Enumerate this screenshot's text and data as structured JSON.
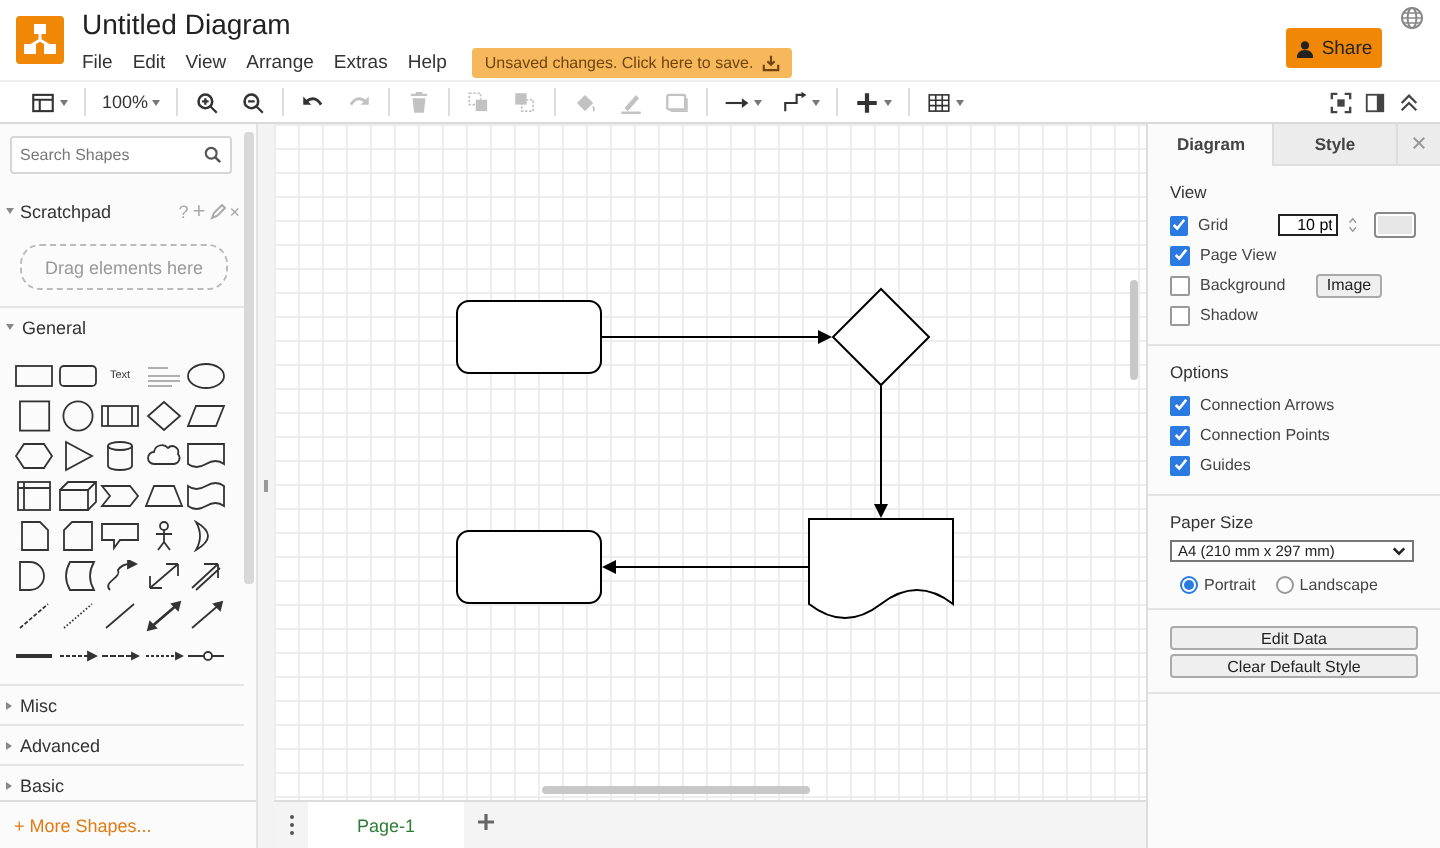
{
  "header": {
    "title": "Untitled Diagram",
    "menu": [
      "File",
      "Edit",
      "View",
      "Arrange",
      "Extras",
      "Help"
    ],
    "save_notice": "Unsaved changes. Click here to save.",
    "share_button": "Share"
  },
  "toolbar": [
    {
      "kind": "layout",
      "disabled": false
    },
    {
      "kind": "zoom",
      "label": "100%",
      "disabled": false
    },
    {
      "kind": "zoom-in",
      "disabled": false
    },
    {
      "kind": "zoom-out",
      "disabled": false
    },
    {
      "kind": "undo",
      "disabled": false
    },
    {
      "kind": "redo",
      "disabled": true
    },
    {
      "kind": "delete",
      "disabled": true
    },
    {
      "kind": "to-front",
      "disabled": true
    },
    {
      "kind": "to-back",
      "disabled": true
    },
    {
      "kind": "fill",
      "disabled": true
    },
    {
      "kind": "line-color",
      "disabled": true
    },
    {
      "kind": "shadow",
      "disabled": true
    },
    {
      "kind": "connection",
      "disabled": false
    },
    {
      "kind": "waypoints",
      "disabled": false
    },
    {
      "kind": "insert",
      "disabled": false
    },
    {
      "kind": "table",
      "disabled": false
    }
  ],
  "sidebar": {
    "search_placeholder": "Search Shapes",
    "scratchpad": {
      "title": "Scratchpad",
      "expanded": true,
      "help": "?",
      "add": "+",
      "close": "×",
      "drop_hint": "Drag elements here"
    },
    "sections": [
      {
        "title": "General",
        "expanded": true
      },
      {
        "title": "Misc",
        "expanded": false
      },
      {
        "title": "Advanced",
        "expanded": false
      },
      {
        "title": "Basic",
        "expanded": false
      }
    ],
    "palette_text_label": "Text",
    "more_shapes": "+ More Shapes..."
  },
  "page_tabs": [
    {
      "label": "Page-1",
      "selected": true
    }
  ],
  "format_panel": {
    "tabs": [
      {
        "label": "Diagram",
        "selected": true
      },
      {
        "label": "Style",
        "selected": false
      }
    ],
    "view": {
      "title": "View",
      "options": [
        {
          "label": "Grid",
          "checked": true,
          "size_field": "10 pt"
        },
        {
          "label": "Page View",
          "checked": true
        },
        {
          "label": "Background",
          "checked": false,
          "button": "Image"
        },
        {
          "label": "Shadow",
          "checked": false
        }
      ]
    },
    "options": {
      "title": "Options",
      "items": [
        {
          "label": "Connection Arrows",
          "checked": true
        },
        {
          "label": "Connection Points",
          "checked": true
        },
        {
          "label": "Guides",
          "checked": true
        }
      ]
    },
    "paper": {
      "title": "Paper Size",
      "size": "A4 (210 mm x 297 mm)",
      "orientations": [
        {
          "label": "Portrait",
          "selected": true
        },
        {
          "label": "Landscape",
          "selected": false
        }
      ]
    },
    "buttons": [
      "Edit Data",
      "Clear Default Style"
    ]
  }
}
